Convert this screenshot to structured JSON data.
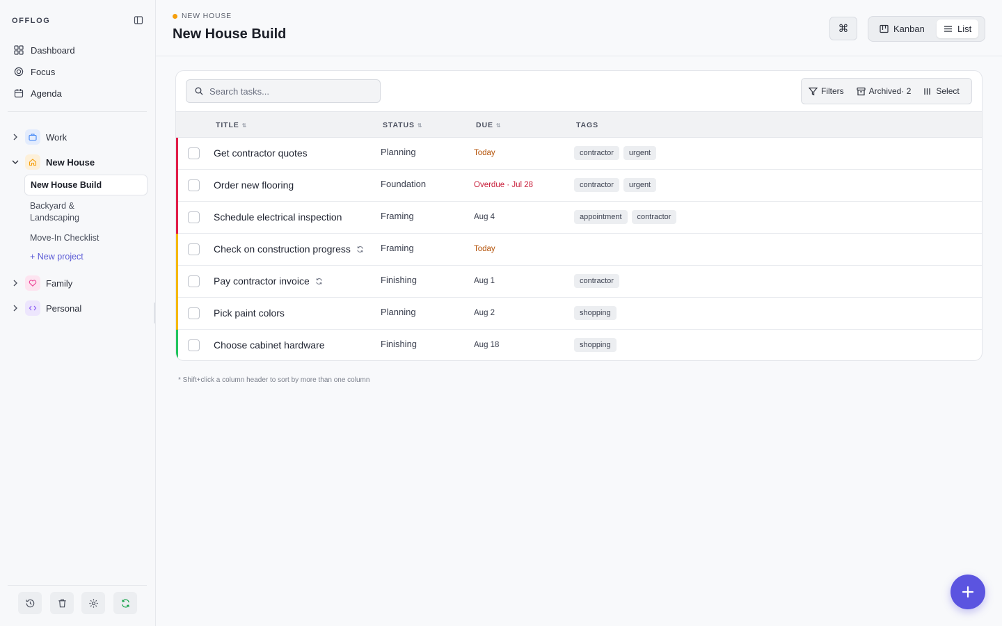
{
  "sidebar": {
    "brand": "OFFLOG",
    "nav": [
      {
        "label": "Dashboard",
        "icon": "grid-icon"
      },
      {
        "label": "Focus",
        "icon": "target-icon"
      },
      {
        "label": "Agenda",
        "icon": "calendar-icon"
      }
    ],
    "areas": {
      "work": {
        "label": "Work",
        "icon": "briefcase-icon",
        "color": "#3b82f6"
      },
      "new_house": {
        "label": "New House",
        "icon": "home-icon",
        "color": "#f59e0b"
      },
      "family": {
        "label": "Family",
        "icon": "heart-icon",
        "color": "#ec4899"
      },
      "personal": {
        "label": "Personal",
        "icon": "code-icon",
        "color": "#8b5cf6"
      }
    },
    "projects": [
      {
        "label": "New House Build"
      },
      {
        "label": "Backyard & Landscaping"
      },
      {
        "label": "Move-In Checklist"
      }
    ],
    "new_project": "+ New project"
  },
  "header": {
    "crumb": "NEW HOUSE",
    "title": "New House Build",
    "cmd": "⌘",
    "views": {
      "kanban": "Kanban",
      "list": "List"
    },
    "active_view": "List"
  },
  "toolbar": {
    "search_placeholder": "Search tasks...",
    "filters": "Filters",
    "archived": "Archived· 2",
    "select": "Select"
  },
  "table": {
    "columns": {
      "title": "TITLE",
      "status": "STATUS",
      "due": "DUE",
      "tags": "TAGS"
    },
    "rows": [
      {
        "title": "Get contractor quotes",
        "status": "Planning",
        "due": "Today",
        "due_kind": "today",
        "tags": [
          "contractor",
          "urgent"
        ],
        "priority_color": "#e11d48",
        "recurring": false
      },
      {
        "title": "Order new flooring",
        "status": "Foundation",
        "due": "Overdue · Jul 28",
        "due_kind": "overdue",
        "tags": [
          "contractor",
          "urgent"
        ],
        "priority_color": "#e11d48",
        "recurring": false
      },
      {
        "title": "Schedule electrical inspection",
        "status": "Framing",
        "due": "Aug 4",
        "due_kind": "normal",
        "tags": [
          "appointment",
          "contractor"
        ],
        "priority_color": "#e11d48",
        "recurring": false
      },
      {
        "title": "Check on construction progress",
        "status": "Framing",
        "due": "Today",
        "due_kind": "today",
        "tags": [],
        "priority_color": "#f5b800",
        "recurring": true
      },
      {
        "title": "Pay contractor invoice",
        "status": "Finishing",
        "due": "Aug 1",
        "due_kind": "normal",
        "tags": [
          "contractor"
        ],
        "priority_color": "#f5b800",
        "recurring": true
      },
      {
        "title": "Pick paint colors",
        "status": "Planning",
        "due": "Aug 2",
        "due_kind": "normal",
        "tags": [
          "shopping"
        ],
        "priority_color": "#f5b800",
        "recurring": false
      },
      {
        "title": "Choose cabinet hardware",
        "status": "Finishing",
        "due": "Aug 18",
        "due_kind": "normal",
        "tags": [
          "shopping"
        ],
        "priority_color": "#22c55e",
        "recurring": false
      }
    ]
  },
  "footnote": "* Shift+click a column header to sort by more than one column",
  "colors": {
    "accent": "#5b54e0"
  }
}
